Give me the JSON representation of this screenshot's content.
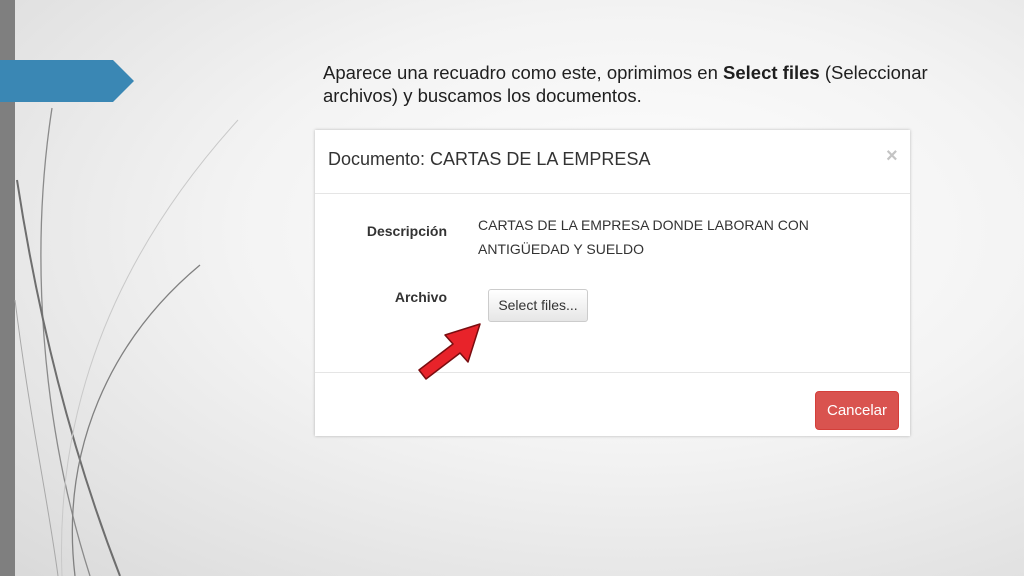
{
  "slide": {
    "caption_before": "Aparece una recuadro como este, oprimimos en ",
    "caption_bold": "Select files",
    "caption_after": " (Seleccionar archivos) y buscamos los documentos."
  },
  "dialog": {
    "title": "Documento: CARTAS DE LA EMPRESA",
    "close_symbol": "×",
    "description_label": "Descripción",
    "description_value": "CARTAS DE LA EMPRESA DONDE LABORAN CON ANTIGÜEDAD Y SUELDO",
    "file_label": "Archivo",
    "select_button": "Select files...",
    "cancel_button": "Cancelar"
  },
  "icons": {
    "pointer_arrow": "red-arrow-icon",
    "close": "close-icon"
  },
  "colors": {
    "slide_tab": "#3a87b4",
    "left_bar": "#7f7f7f",
    "pointer_arrow": "#e8232a",
    "cancel_button": "#d9534f"
  }
}
